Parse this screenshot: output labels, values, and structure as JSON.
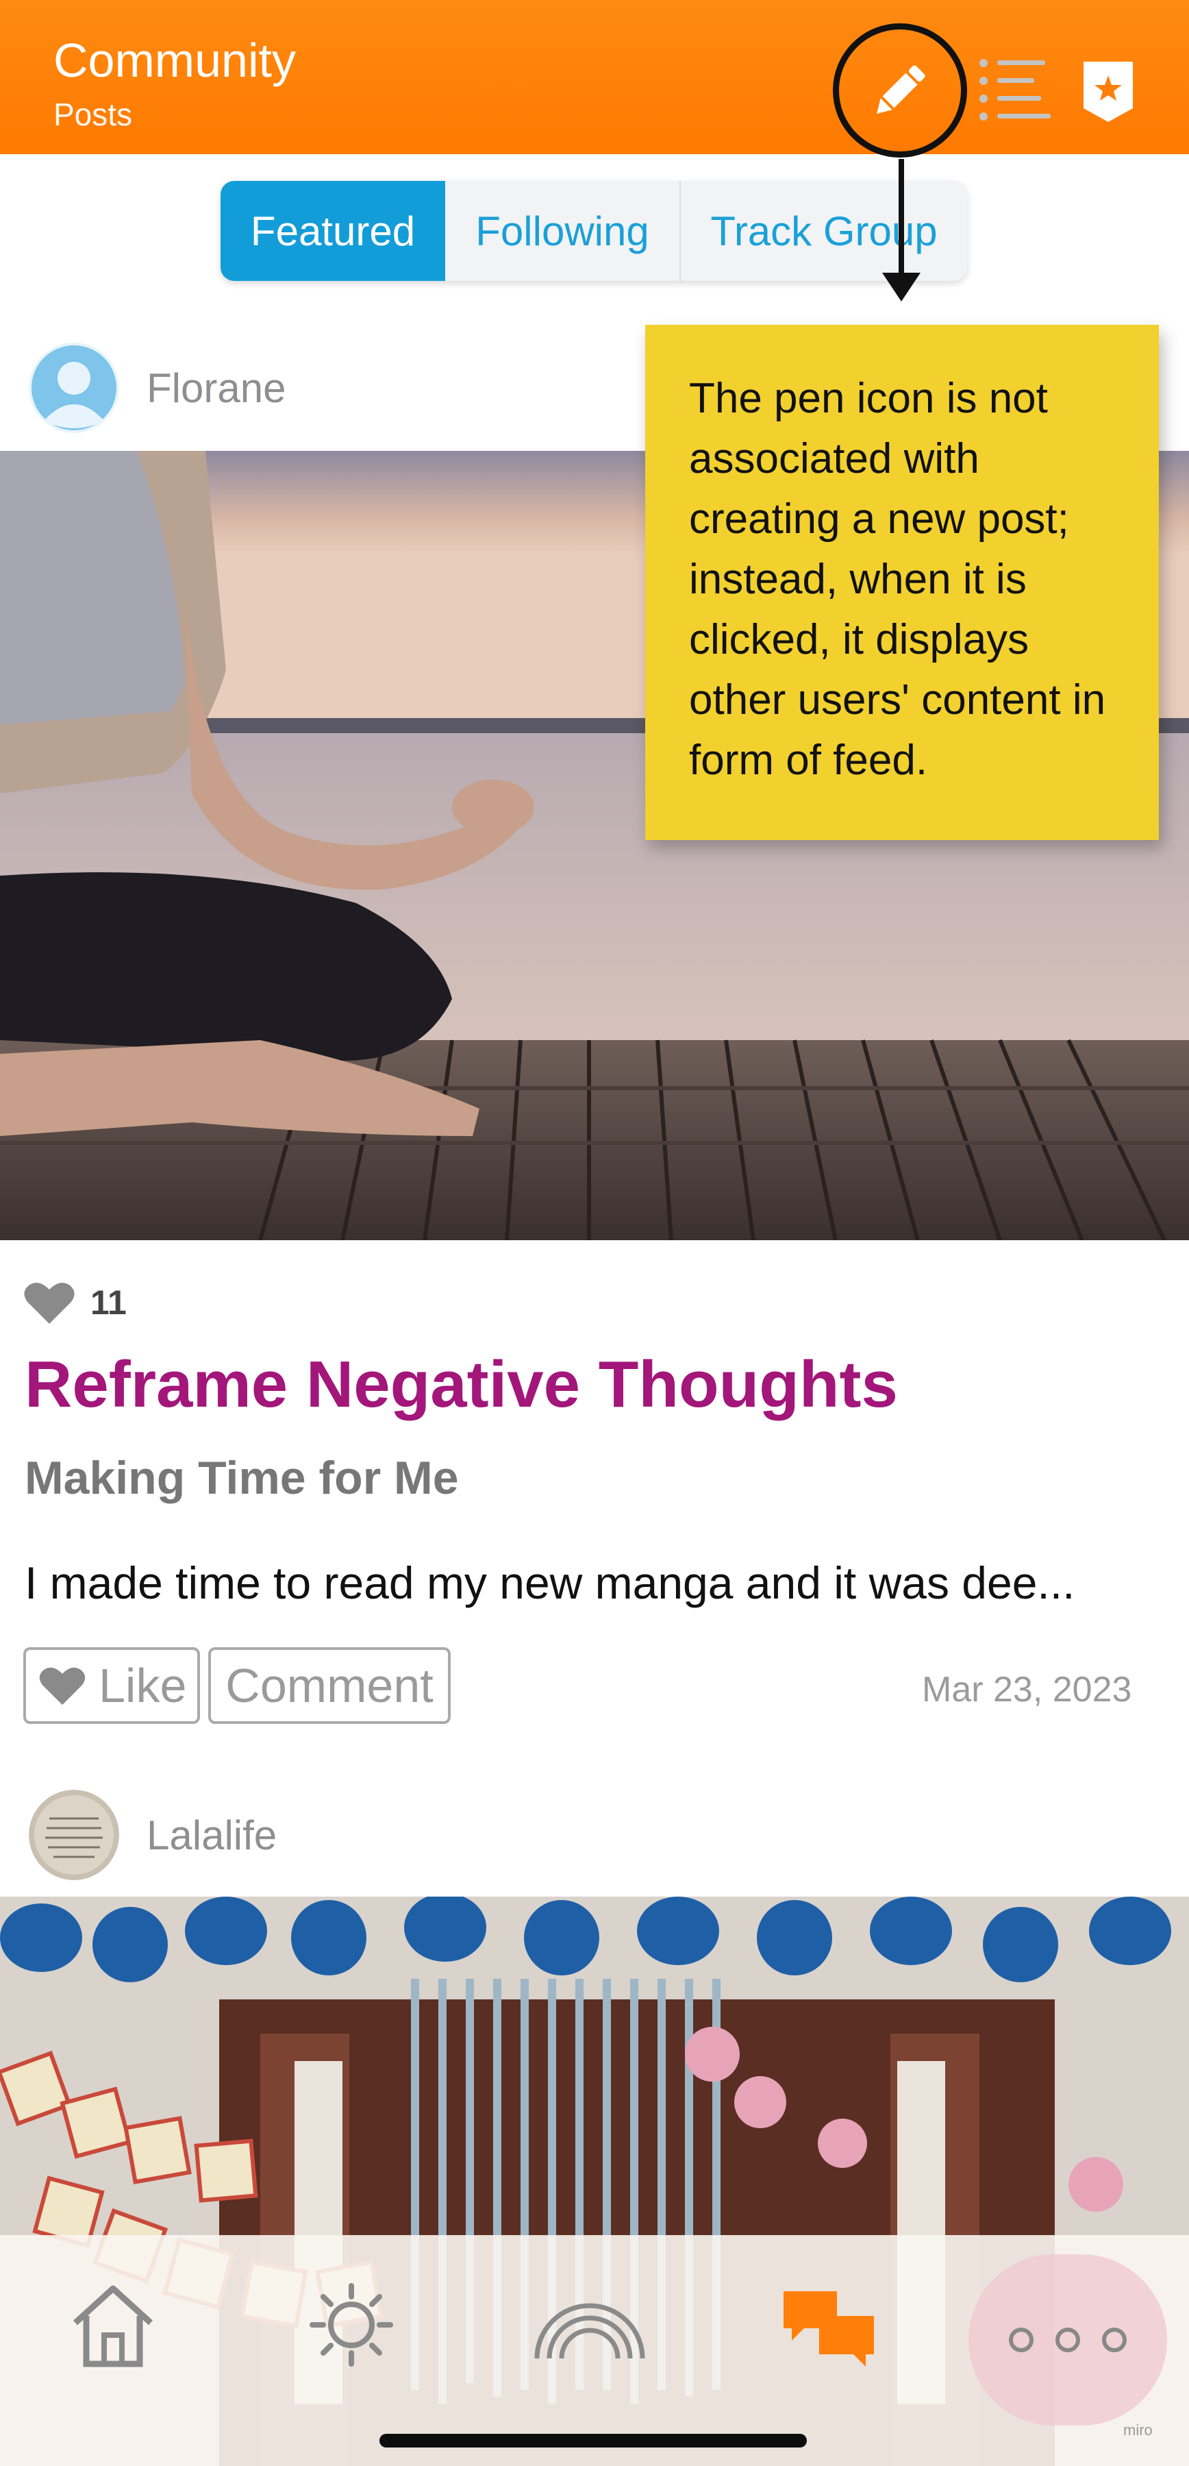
{
  "header": {
    "title": "Community",
    "subtitle": "Posts",
    "icons": [
      "pen-icon",
      "list-icon",
      "star-badge-icon"
    ],
    "accent_color": "#ff7f0a"
  },
  "tabs": [
    {
      "label": "Featured",
      "active": true
    },
    {
      "label": "Following",
      "active": false
    },
    {
      "label": "Track Group",
      "active": false
    }
  ],
  "annotation": {
    "note": "The pen icon is not associated with creating a new post; instead, when it is clicked, it displays other users' content in form of feed.",
    "note_color": "#f2d02e"
  },
  "posts": [
    {
      "author": "Florane",
      "likes": "11",
      "title": "Reframe Negative Thoughts",
      "subtitle": "Making Time for Me",
      "excerpt": "I made time to read my new manga and it was dee...",
      "like_label": "Like",
      "comment_label": "Comment",
      "date": "Mar 23, 2023"
    },
    {
      "author": "Lalalife"
    }
  ],
  "bottom_nav": {
    "items": [
      "home-icon",
      "sun-icon",
      "rainbow-icon",
      "chat-bubbles-icon",
      "more-icon"
    ]
  },
  "watermark": "miro"
}
